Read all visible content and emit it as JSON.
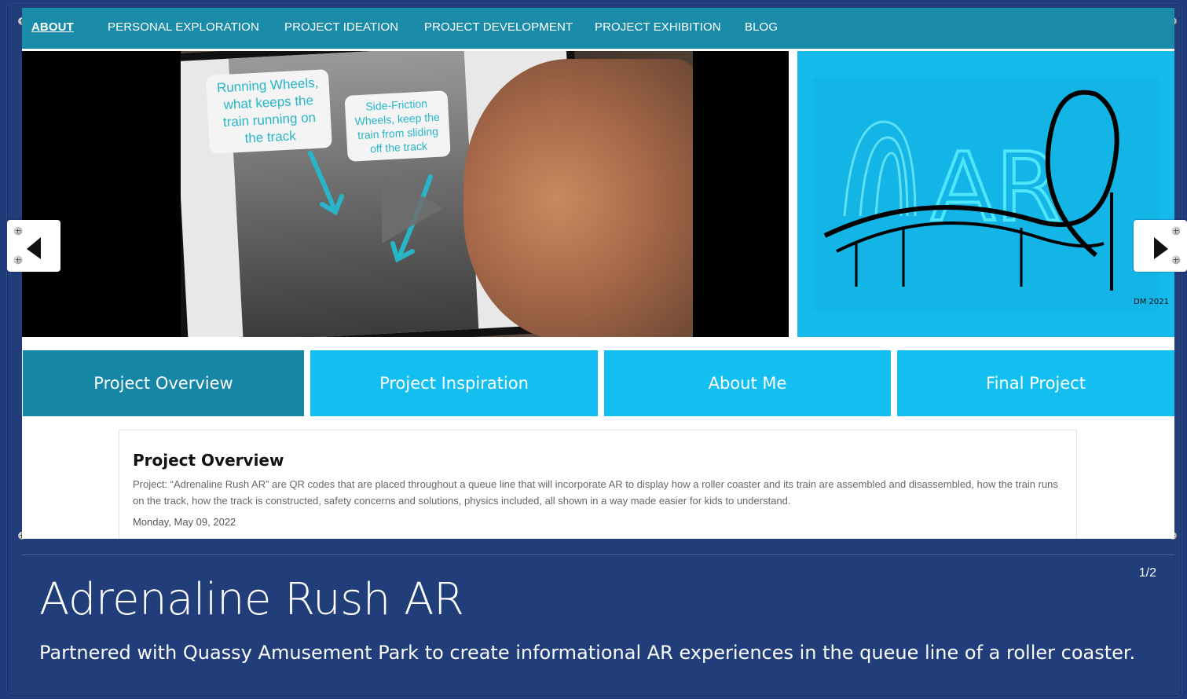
{
  "nav": {
    "items": [
      {
        "label": "ABOUT",
        "active": true
      },
      {
        "label": "PERSONAL EXPLORATION"
      },
      {
        "label": "PROJECT IDEATION"
      },
      {
        "label": "PROJECT DEVELOPMENT"
      },
      {
        "label": "PROJECT EXHIBITION"
      },
      {
        "label": "BLOG"
      }
    ]
  },
  "video": {
    "note_left": "Running Wheels, what keeps the train running on the track",
    "note_right": "Side-Friction Wheels, keep the train from sliding off the track",
    "play_icon": "play-icon"
  },
  "art": {
    "caption": "AR",
    "signature": "DM 2021"
  },
  "tabs": [
    {
      "label": "Project Overview",
      "active": true
    },
    {
      "label": "Project Inspiration"
    },
    {
      "label": "About Me"
    },
    {
      "label": "Final Project"
    }
  ],
  "overview": {
    "title": "Project Overview",
    "body": "Project: “Adrenaline Rush AR” are QR codes that are placed throughout a queue line that will incorporate AR to display how a roller coaster and its train are assembled and disassembled, how the train runs on the track, how the track is constructed, safety concerns and solutions, physics included, all shown in a way made easier for kids to understand.",
    "date": "Monday, May 09, 2022"
  },
  "carousel": {
    "counter": "1/2",
    "prev_icon": "left-arrow-icon",
    "next_icon": "right-arrow-icon"
  },
  "caption": {
    "title": "Adrenaline Rush AR",
    "subtitle": "Partnered with Quassy Amusement Park to create informational AR experiences in the queue line of a roller coaster."
  },
  "colors": {
    "nav": "#1a8ba8",
    "tab": "#12bff0",
    "tab_active": "#1586a6",
    "frame": "#213d7a",
    "art_bg": "#15b9ec"
  }
}
